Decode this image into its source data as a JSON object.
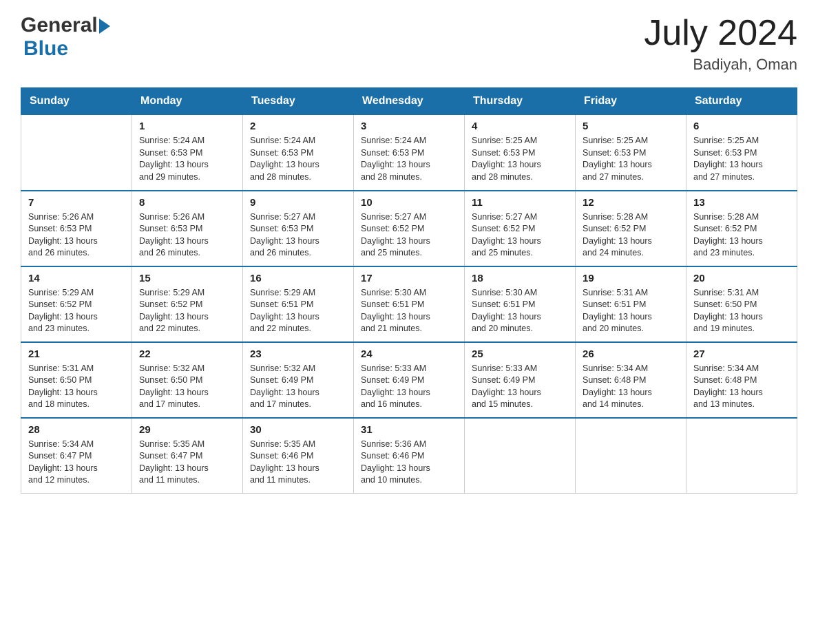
{
  "header": {
    "logo_general": "General",
    "logo_blue": "Blue",
    "month_year": "July 2024",
    "location": "Badiyah, Oman"
  },
  "weekdays": [
    "Sunday",
    "Monday",
    "Tuesday",
    "Wednesday",
    "Thursday",
    "Friday",
    "Saturday"
  ],
  "weeks": [
    [
      {
        "day": "",
        "info": ""
      },
      {
        "day": "1",
        "info": "Sunrise: 5:24 AM\nSunset: 6:53 PM\nDaylight: 13 hours\nand 29 minutes."
      },
      {
        "day": "2",
        "info": "Sunrise: 5:24 AM\nSunset: 6:53 PM\nDaylight: 13 hours\nand 28 minutes."
      },
      {
        "day": "3",
        "info": "Sunrise: 5:24 AM\nSunset: 6:53 PM\nDaylight: 13 hours\nand 28 minutes."
      },
      {
        "day": "4",
        "info": "Sunrise: 5:25 AM\nSunset: 6:53 PM\nDaylight: 13 hours\nand 28 minutes."
      },
      {
        "day": "5",
        "info": "Sunrise: 5:25 AM\nSunset: 6:53 PM\nDaylight: 13 hours\nand 27 minutes."
      },
      {
        "day": "6",
        "info": "Sunrise: 5:25 AM\nSunset: 6:53 PM\nDaylight: 13 hours\nand 27 minutes."
      }
    ],
    [
      {
        "day": "7",
        "info": "Sunrise: 5:26 AM\nSunset: 6:53 PM\nDaylight: 13 hours\nand 26 minutes."
      },
      {
        "day": "8",
        "info": "Sunrise: 5:26 AM\nSunset: 6:53 PM\nDaylight: 13 hours\nand 26 minutes."
      },
      {
        "day": "9",
        "info": "Sunrise: 5:27 AM\nSunset: 6:53 PM\nDaylight: 13 hours\nand 26 minutes."
      },
      {
        "day": "10",
        "info": "Sunrise: 5:27 AM\nSunset: 6:52 PM\nDaylight: 13 hours\nand 25 minutes."
      },
      {
        "day": "11",
        "info": "Sunrise: 5:27 AM\nSunset: 6:52 PM\nDaylight: 13 hours\nand 25 minutes."
      },
      {
        "day": "12",
        "info": "Sunrise: 5:28 AM\nSunset: 6:52 PM\nDaylight: 13 hours\nand 24 minutes."
      },
      {
        "day": "13",
        "info": "Sunrise: 5:28 AM\nSunset: 6:52 PM\nDaylight: 13 hours\nand 23 minutes."
      }
    ],
    [
      {
        "day": "14",
        "info": "Sunrise: 5:29 AM\nSunset: 6:52 PM\nDaylight: 13 hours\nand 23 minutes."
      },
      {
        "day": "15",
        "info": "Sunrise: 5:29 AM\nSunset: 6:52 PM\nDaylight: 13 hours\nand 22 minutes."
      },
      {
        "day": "16",
        "info": "Sunrise: 5:29 AM\nSunset: 6:51 PM\nDaylight: 13 hours\nand 22 minutes."
      },
      {
        "day": "17",
        "info": "Sunrise: 5:30 AM\nSunset: 6:51 PM\nDaylight: 13 hours\nand 21 minutes."
      },
      {
        "day": "18",
        "info": "Sunrise: 5:30 AM\nSunset: 6:51 PM\nDaylight: 13 hours\nand 20 minutes."
      },
      {
        "day": "19",
        "info": "Sunrise: 5:31 AM\nSunset: 6:51 PM\nDaylight: 13 hours\nand 20 minutes."
      },
      {
        "day": "20",
        "info": "Sunrise: 5:31 AM\nSunset: 6:50 PM\nDaylight: 13 hours\nand 19 minutes."
      }
    ],
    [
      {
        "day": "21",
        "info": "Sunrise: 5:31 AM\nSunset: 6:50 PM\nDaylight: 13 hours\nand 18 minutes."
      },
      {
        "day": "22",
        "info": "Sunrise: 5:32 AM\nSunset: 6:50 PM\nDaylight: 13 hours\nand 17 minutes."
      },
      {
        "day": "23",
        "info": "Sunrise: 5:32 AM\nSunset: 6:49 PM\nDaylight: 13 hours\nand 17 minutes."
      },
      {
        "day": "24",
        "info": "Sunrise: 5:33 AM\nSunset: 6:49 PM\nDaylight: 13 hours\nand 16 minutes."
      },
      {
        "day": "25",
        "info": "Sunrise: 5:33 AM\nSunset: 6:49 PM\nDaylight: 13 hours\nand 15 minutes."
      },
      {
        "day": "26",
        "info": "Sunrise: 5:34 AM\nSunset: 6:48 PM\nDaylight: 13 hours\nand 14 minutes."
      },
      {
        "day": "27",
        "info": "Sunrise: 5:34 AM\nSunset: 6:48 PM\nDaylight: 13 hours\nand 13 minutes."
      }
    ],
    [
      {
        "day": "28",
        "info": "Sunrise: 5:34 AM\nSunset: 6:47 PM\nDaylight: 13 hours\nand 12 minutes."
      },
      {
        "day": "29",
        "info": "Sunrise: 5:35 AM\nSunset: 6:47 PM\nDaylight: 13 hours\nand 11 minutes."
      },
      {
        "day": "30",
        "info": "Sunrise: 5:35 AM\nSunset: 6:46 PM\nDaylight: 13 hours\nand 11 minutes."
      },
      {
        "day": "31",
        "info": "Sunrise: 5:36 AM\nSunset: 6:46 PM\nDaylight: 13 hours\nand 10 minutes."
      },
      {
        "day": "",
        "info": ""
      },
      {
        "day": "",
        "info": ""
      },
      {
        "day": "",
        "info": ""
      }
    ]
  ]
}
